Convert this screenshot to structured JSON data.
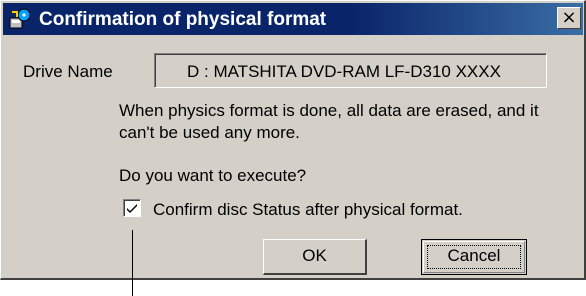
{
  "window": {
    "title": "Confirmation of physical format",
    "close_glyph": "×",
    "icon": "format-disc-icon"
  },
  "drive": {
    "label": "Drive Name",
    "value": "D : MATSHITA DVD-RAM LF-D310 XXXX"
  },
  "message": {
    "warning": "When physics format is done, all data are erased, and it can't be used any more.",
    "question": "Do you want to execute?"
  },
  "option": {
    "label": "Confirm disc Status after physical format.",
    "checked": true
  },
  "buttons": {
    "ok": "OK",
    "cancel": "Cancel"
  },
  "colors": {
    "face": "#d4d0c8",
    "title_bar": "#0a246a"
  }
}
